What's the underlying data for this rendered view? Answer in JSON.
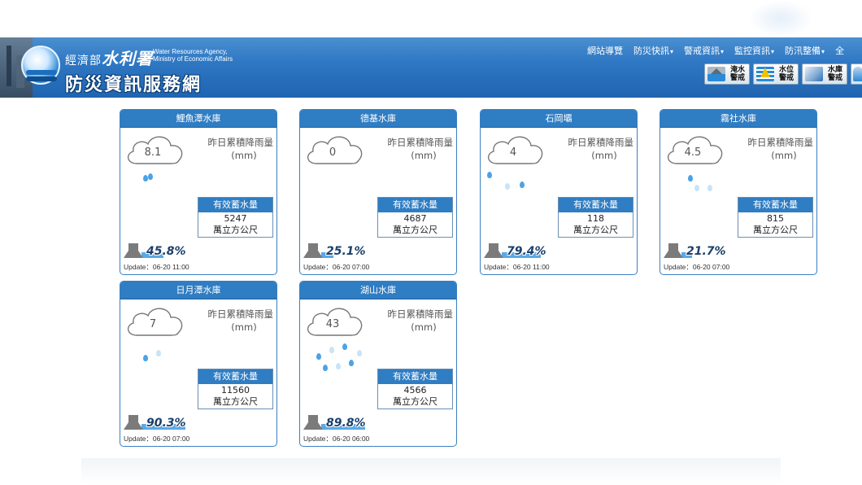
{
  "header": {
    "agency_zh_small": "經濟部",
    "agency_zh_big": "水利署",
    "agency_en_line1": "Water Resources Agency,",
    "agency_en_line2": "Ministry of Economic Affairs",
    "site_title": "防災資訊服務網",
    "nav": [
      {
        "label": "網站導覽",
        "has_caret": false
      },
      {
        "label": "防災快訊",
        "has_caret": true
      },
      {
        "label": "警戒資訊",
        "has_caret": true
      },
      {
        "label": "監控資訊",
        "has_caret": true
      },
      {
        "label": "防汛整備",
        "has_caret": true
      },
      {
        "label": "全",
        "has_caret": false
      }
    ],
    "alert_buttons": [
      {
        "icon": "flood-warning-icon",
        "label_line1": "淹水",
        "label_line2": "警戒"
      },
      {
        "icon": "water-level-warning-icon",
        "label_line1": "水位",
        "label_line2": "警戒"
      },
      {
        "icon": "reservoir-warning-icon",
        "label_line1": "水庫",
        "label_line2": "警戒"
      }
    ]
  },
  "labels": {
    "rain_line1": "昨日累積降雨量",
    "rain_unit": "(mm)",
    "storage_head": "有效蓄水量",
    "storage_unit": "萬立方公尺"
  },
  "reservoirs": [
    {
      "name": "鯉魚潭水庫",
      "rain": "8.1",
      "storage": "5247",
      "percent": "45.8%",
      "percent_value": 45.8,
      "update": "Update：06-20 11:00"
    },
    {
      "name": "德基水庫",
      "rain": "0",
      "storage": "4687",
      "percent": "25.1%",
      "percent_value": 25.1,
      "update": "Update：06-20 07:00"
    },
    {
      "name": "石岡壩",
      "rain": "4",
      "storage": "118",
      "percent": "79.4%",
      "percent_value": 79.4,
      "update": "Update：06-20 11:00"
    },
    {
      "name": "霧社水庫",
      "rain": "4.5",
      "storage": "815",
      "percent": "21.7%",
      "percent_value": 21.7,
      "update": "Update：06-20 07:00"
    },
    {
      "name": "日月潭水庫",
      "rain": "7",
      "storage": "11560",
      "percent": "90.3%",
      "percent_value": 90.3,
      "update": "Update：06-20 07:00"
    },
    {
      "name": "湖山水庫",
      "rain": "43",
      "storage": "4566",
      "percent": "89.8%",
      "percent_value": 89.8,
      "update": "Update：06-20 06:00"
    }
  ]
}
